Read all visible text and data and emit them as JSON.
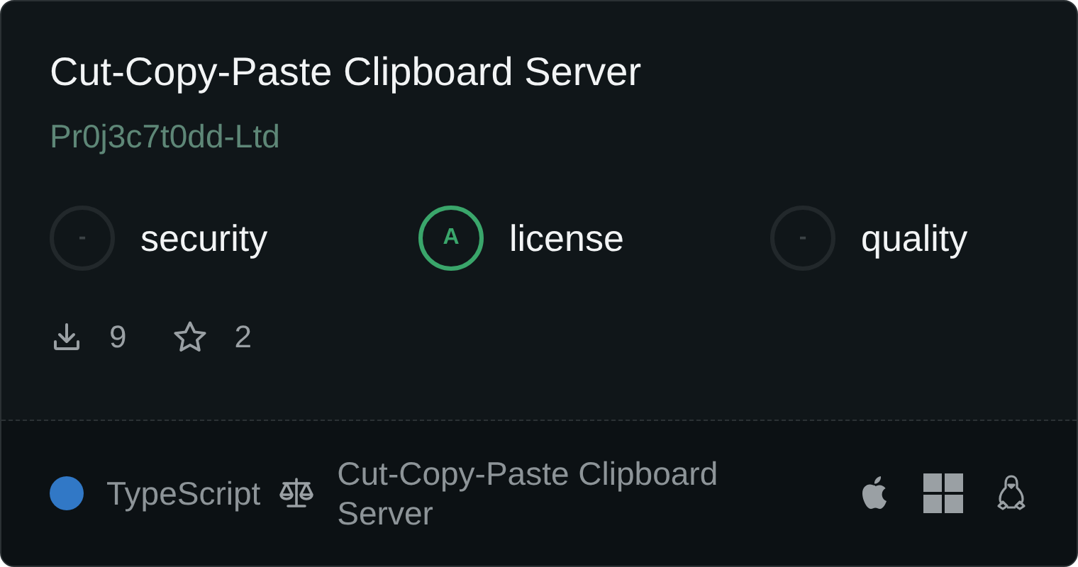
{
  "title": "Cut-Copy-Paste Clipboard Server",
  "publisher": "Pr0j3c7t0dd-Ltd",
  "scores": [
    {
      "grade": "-",
      "label": "security",
      "rated": false
    },
    {
      "grade": "A",
      "label": "license",
      "rated": true
    },
    {
      "grade": "-",
      "label": "quality",
      "rated": false
    }
  ],
  "stats": {
    "downloads": "9",
    "stars": "2"
  },
  "footer": {
    "language": {
      "name": "TypeScript",
      "color": "#3178c6"
    },
    "license": "Cut-Copy-Paste Clipboard Server",
    "platforms": [
      {
        "kind": "apple"
      },
      {
        "kind": "windows"
      },
      {
        "kind": "linux"
      }
    ]
  }
}
